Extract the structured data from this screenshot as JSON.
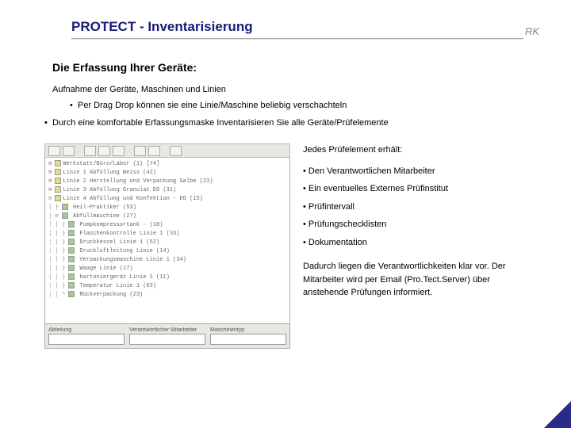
{
  "header": {
    "title": "PROTECT - Inventarisierung",
    "logo": "RK"
  },
  "subtitle": "Die Erfassung Ihrer Geräte:",
  "intro": "Aufnahme der Geräte, Maschinen und Linien",
  "sub_bullet": "Per Drag Drop können sie eine Linie/Maschine beliebig verschachteln",
  "main_bullet": "Durch eine komfortable Erfassungsmaske Inventarisieren Sie alle Geräte/Prüfelemente",
  "right": {
    "heading": "Jedes Prüfelement erhält:",
    "items": [
      "Den Verantwortlichen Mitarbeiter",
      "Ein eventuelles Externes Prüfinstitut",
      "Prüfintervall",
      "Prüfungschecklisten",
      "Dokumentation"
    ],
    "footer": "Dadurch liegen die Verantwortlichkeiten klar vor. Der Mitarbeiter wird per Email (Pro.Tect.Server) über anstehende Prüfungen informiert."
  },
  "form": {
    "labels": [
      "Abteilung",
      "Verantwortlicher Mitarbeiter",
      "Maschinentyp"
    ],
    "values": [
      "",
      "",
      ""
    ]
  },
  "tree": [
    "Werkstatt/Büro/Labor (1) [74]",
    "Linie 1 Abfüllung Weiss (42)",
    "Linie 2 Herstellung und Verpackung Salbe (23)",
    "Linie 3 Abfüllung Granulat EG (31)",
    "Linie 4 Abfüllung und Konfektion - EG (15)",
    "  Heil-Praktiker (53)",
    "  Abfüllmaschine (27)",
    "    Pumpkompressortank - (18)",
    "    Flaschenkontrolle Linie 1 (33)",
    "    Druckkessel Linie 1 (52)",
    "    Druckluftleitung Linie (14)",
    "    Verpackungsmaschine Linie 1 (34)",
    "    Waage Linie (17)",
    "    Kartoniergerät Linie 1 (11)",
    "    Temperatur Linie 1 (03)",
    "    Rückverpackung (23)"
  ]
}
